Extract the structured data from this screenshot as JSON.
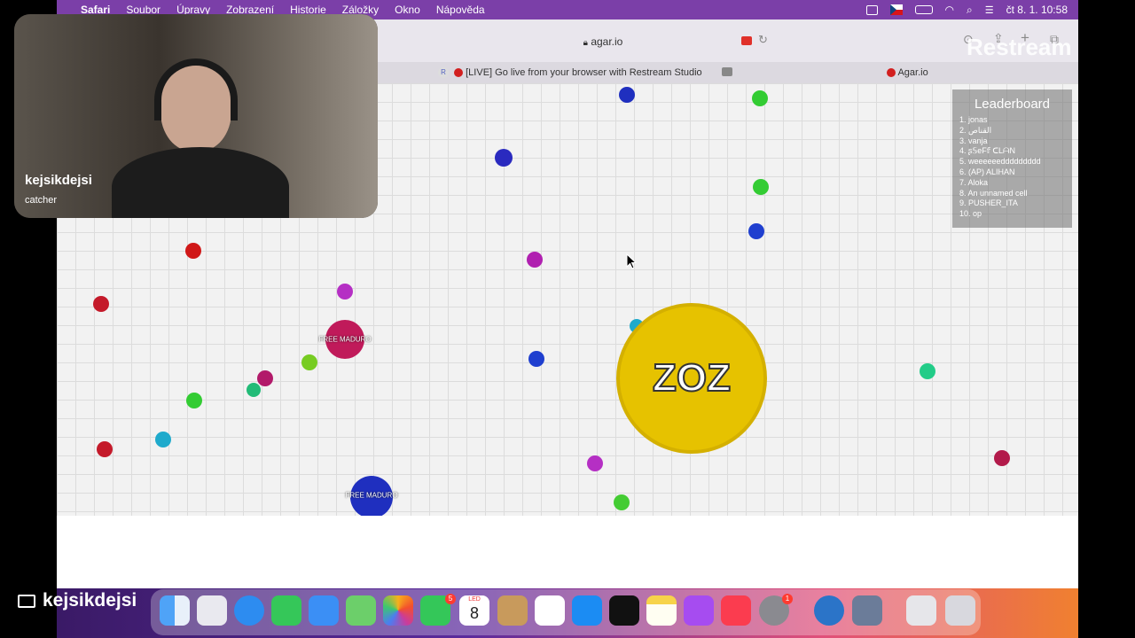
{
  "menubar": {
    "app": "Safari",
    "items": [
      "Soubor",
      "Úpravy",
      "Zobrazení",
      "Historie",
      "Záložky",
      "Okno",
      "Nápověda"
    ],
    "clock": "čt 8. 1.  10:58"
  },
  "browser": {
    "url": "agar.io",
    "tabs": [
      {
        "label": "[LIVE] Go live from your browser with Restream Studio"
      },
      {
        "label": "Agar.io"
      }
    ]
  },
  "webcam": {
    "name": "kejsikdejsi",
    "role": "catcher"
  },
  "watermark": "Restream",
  "game": {
    "player_name": "ZOZ",
    "cell_labels": [
      "FREE MADURO",
      "FREE MADURO"
    ],
    "leaderboard": {
      "title": "Leaderboard",
      "entries": [
        "1. jonas",
        "2. القناص",
        "3. vanja",
        "4. ʂ𝕊eF𝕗   ᑕLᗩN",
        "5. weeeeeeddddddddd",
        "6. (AP) ALIHAN",
        "7. Aloka",
        "8. An unnamed cell",
        "9. PUSHER_ITA",
        "10. op"
      ]
    }
  },
  "dock": {
    "stream_name": "kejsikdejsi",
    "calendar_month": "LED",
    "calendar_day": "8",
    "badges": {
      "facetime": "5",
      "settings": "1"
    },
    "apps": [
      "finder",
      "launchpad",
      "safari",
      "messages",
      "mail",
      "maps",
      "photos",
      "facetime",
      "calendar",
      "contacts",
      "reminders",
      "app-store",
      "apple-tv",
      "notes",
      "podcasts",
      "music",
      "system-settings",
      "quicktime",
      "screenshot",
      "preview",
      "trash"
    ]
  },
  "colors": {
    "menubar": "#7b3fa8",
    "player": "#e6c200",
    "grid_background": "#f2f2f2"
  }
}
